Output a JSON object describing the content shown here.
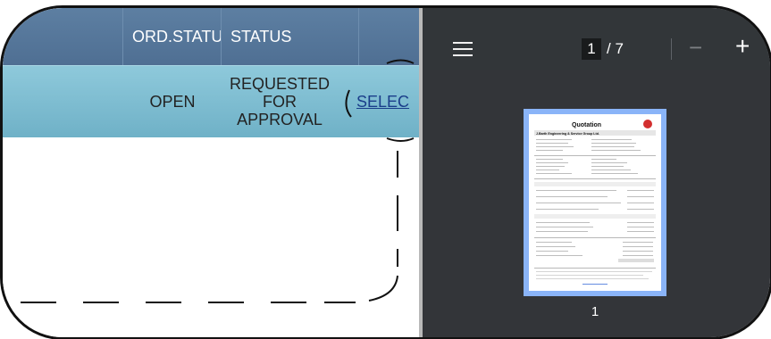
{
  "table": {
    "header": {
      "col_ord_status": "ORD.STATU",
      "col_status": "STATUS"
    },
    "filters": {
      "open": "OPEN",
      "requested_lines": [
        "REQUESTED",
        "FOR",
        "APPROVAL"
      ],
      "select_link": "SELEC"
    }
  },
  "viewer": {
    "page_current": "1",
    "page_total": "/ 7",
    "zoom_out": "−",
    "zoom_in": "+",
    "thumbnail_label": "1",
    "icons": [
      "menu-icon",
      "zoom-out-icon",
      "zoom-in-icon"
    ],
    "thumbnail_title": "Quotation",
    "thumbnail_company": "J.Barth Engineering & Service Group Ltd.",
    "accent": "#8ab4f8"
  }
}
